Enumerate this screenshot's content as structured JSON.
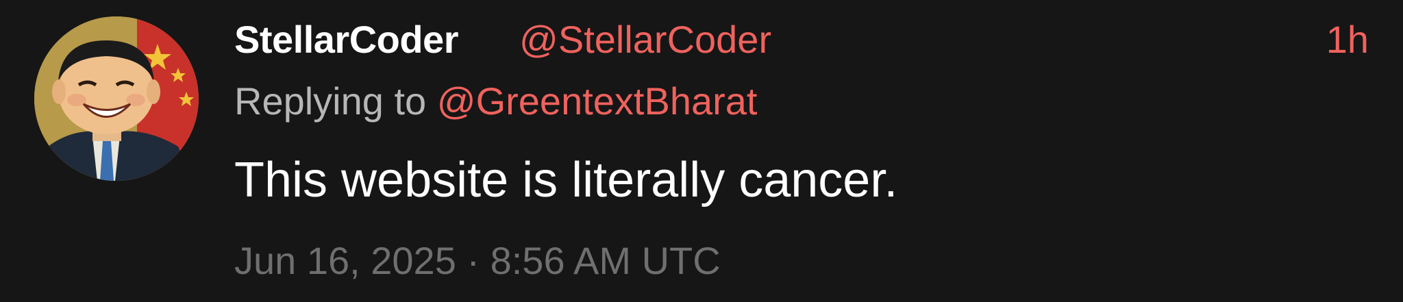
{
  "author": {
    "display_name": "StellarCoder",
    "handle": "@StellarCoder",
    "avatar_icon": "cartoon-portrait-avatar"
  },
  "relative_time": "1h",
  "reply": {
    "prefix": "Replying to ",
    "handle": "@GreentextBharat"
  },
  "body": "This website is literally cancer.",
  "timestamp": "Jun 16, 2025 · 8:56 AM UTC",
  "colors": {
    "background": "#161616",
    "accent": "#f0625d",
    "primary_text": "#ffffff",
    "secondary_text": "#b7b7b7",
    "muted_text": "#6f6f6f"
  }
}
